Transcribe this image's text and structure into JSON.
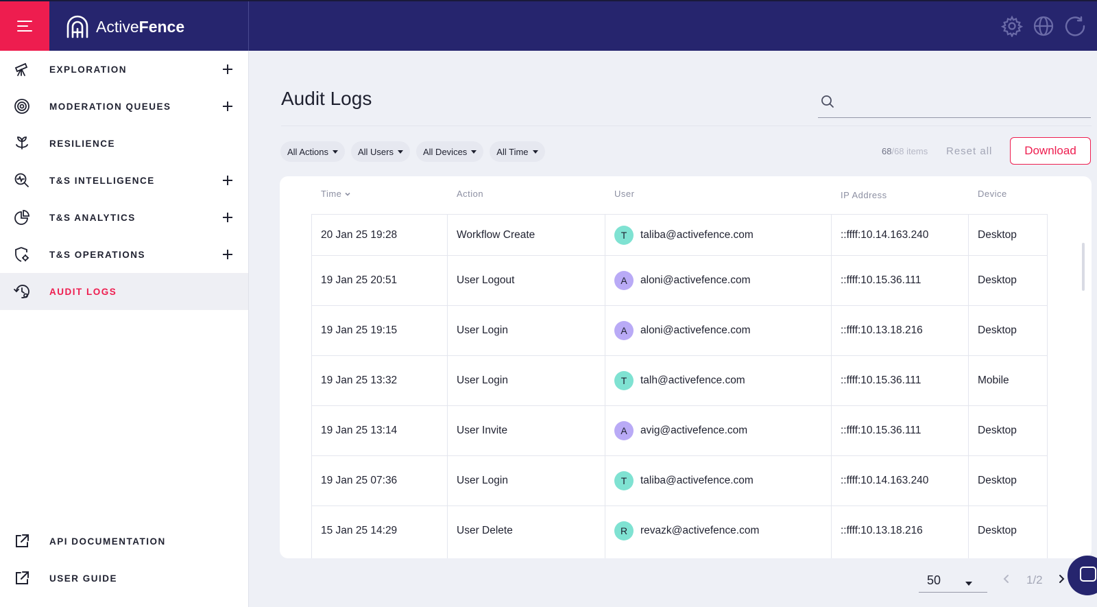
{
  "brand": {
    "name_regular": "Active",
    "name_bold": "Fence"
  },
  "colors": {
    "accent": "#ee1d4f",
    "topbar": "#26256e",
    "avatar_t": "#7fe2d2",
    "avatar_a": "#b9aaf6"
  },
  "topbar_icons": [
    "gear-icon",
    "globe-icon",
    "refresh-icon"
  ],
  "sidebar": {
    "items": [
      {
        "label": "EXPLORATION",
        "icon": "telescope-icon",
        "expandable": true
      },
      {
        "label": "MODERATION QUEUES",
        "icon": "target-icon",
        "expandable": true
      },
      {
        "label": "RESILIENCE",
        "icon": "sprout-icon",
        "expandable": false
      },
      {
        "label": "T&S INTELLIGENCE",
        "icon": "search-pulse-icon",
        "expandable": true
      },
      {
        "label": "T&S ANALYTICS",
        "icon": "pie-chart-icon",
        "expandable": true
      },
      {
        "label": "T&S OPERATIONS",
        "icon": "shield-gear-icon",
        "expandable": true
      },
      {
        "label": "AUDIT LOGS",
        "icon": "history-gear-icon",
        "expandable": false,
        "active": true
      }
    ],
    "footer": [
      {
        "label": "API DOCUMENTATION",
        "icon": "external-link-icon"
      },
      {
        "label": "USER GUIDE",
        "icon": "external-link-icon"
      }
    ]
  },
  "main": {
    "title": "Audit Logs",
    "search_placeholder": "",
    "filters": [
      "All Actions",
      "All Users",
      "All Devices",
      "All Time"
    ],
    "count_shown": "68",
    "count_total": "/68 items",
    "reset_label": "Reset all",
    "download_label": "Download"
  },
  "table": {
    "columns": [
      "Time",
      "Action",
      "User",
      "IP Address",
      "Device"
    ],
    "rows": [
      {
        "time": "20 Jan 25 19:28",
        "action": "Workflow Create",
        "initial": "T",
        "user": "taliba@activefence.com",
        "ip": "::ffff:10.14.163.240",
        "device": "Desktop"
      },
      {
        "time": "19 Jan 25 20:51",
        "action": "User Logout",
        "initial": "A",
        "user": "aloni@activefence.com",
        "ip": "::ffff:10.15.36.111",
        "device": "Desktop"
      },
      {
        "time": "19 Jan 25 19:15",
        "action": "User Login",
        "initial": "A",
        "user": "aloni@activefence.com",
        "ip": "::ffff:10.13.18.216",
        "device": "Desktop"
      },
      {
        "time": "19 Jan 25 13:32",
        "action": "User Login",
        "initial": "T",
        "user": "talh@activefence.com",
        "ip": "::ffff:10.15.36.111",
        "device": "Mobile"
      },
      {
        "time": "19 Jan 25 13:14",
        "action": "User Invite",
        "initial": "A",
        "user": "avig@activefence.com",
        "ip": "::ffff:10.15.36.111",
        "device": "Desktop"
      },
      {
        "time": "19 Jan 25 07:36",
        "action": "User Login",
        "initial": "T",
        "user": "taliba@activefence.com",
        "ip": "::ffff:10.14.163.240",
        "device": "Desktop"
      },
      {
        "time": "15 Jan 25 14:29",
        "action": "User Delete",
        "initial": "R",
        "user": "revazk@activefence.com",
        "ip": "::ffff:10.13.18.216",
        "device": "Desktop"
      }
    ]
  },
  "pagination": {
    "page_size": "50",
    "page": "1/2"
  }
}
